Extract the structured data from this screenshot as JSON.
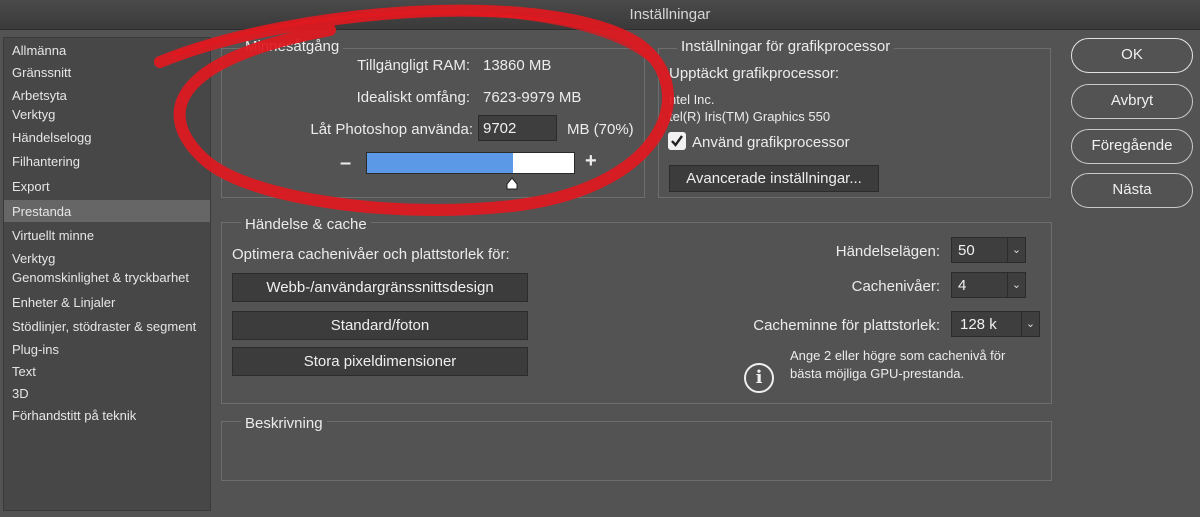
{
  "window": {
    "title": "Inställningar"
  },
  "sidebar": {
    "items": [
      {
        "label": "Allmänna"
      },
      {
        "label": "Gränssnitt"
      },
      {
        "label": "Arbetsyta"
      },
      {
        "label": "Verktyg"
      },
      {
        "label": "Händelselogg"
      },
      {
        "label": "Filhantering"
      },
      {
        "label": "Export"
      },
      {
        "label": "Prestanda"
      },
      {
        "label": "Virtuellt minne"
      },
      {
        "label": "Verktyg"
      },
      {
        "label": "Genomskinlighet & tryckbarhet"
      },
      {
        "label": "Enheter & Linjaler"
      },
      {
        "label": "Stödlinjer, stödraster & segment"
      },
      {
        "label": "Plug-ins"
      },
      {
        "label": "Text"
      },
      {
        "label": "3D"
      },
      {
        "label": "Förhandstitt på teknik"
      }
    ],
    "selected": "Prestanda"
  },
  "memory": {
    "title": "Minnesåtgång",
    "available_label": "Tillgängligt RAM:",
    "available_value": "13860 MB",
    "ideal_label": "Idealiskt omfång:",
    "ideal_value": "7623-9979 MB",
    "use_label": "Låt Photoshop använda:",
    "use_value": "9702",
    "use_unit": "MB (70%)",
    "minus": "–",
    "plus": "+",
    "slider_fraction": 0.7
  },
  "gpu": {
    "title": "Inställningar för grafikprocessor",
    "detected_label": "Upptäckt grafikprocessor:",
    "vendor": "ntel Inc.",
    "model": "tel(R) Iris(TM) Graphics 550",
    "use_gpu_label": "Använd grafikprocessor",
    "use_gpu_checked": true,
    "advanced_button": "Avancerade inställningar..."
  },
  "history": {
    "title": "Händelse & cache",
    "optimize_label": "Optimera cachenivåer och plattstorlek för:",
    "buttons": [
      "Webb-/användargränssnittsdesign",
      "Standard/foton",
      "Stora pixeldimensioner"
    ],
    "history_states_label": "Händelselägen:",
    "history_states_value": "50",
    "cache_levels_label": "Cachenivåer:",
    "cache_levels_value": "4",
    "tile_size_label": "Cacheminne för plattstorlek:",
    "tile_size_value": "128 k",
    "info_text_1": "Ange 2 eller högre som cachenivå för",
    "info_text_2": "bästa möjliga GPU-prestanda."
  },
  "description": {
    "title": "Beskrivning"
  },
  "actions": {
    "ok": "OK",
    "cancel": "Avbryt",
    "prev": "Föregående",
    "next": "Nästa"
  },
  "annotation": {
    "color": "#e0191f"
  }
}
